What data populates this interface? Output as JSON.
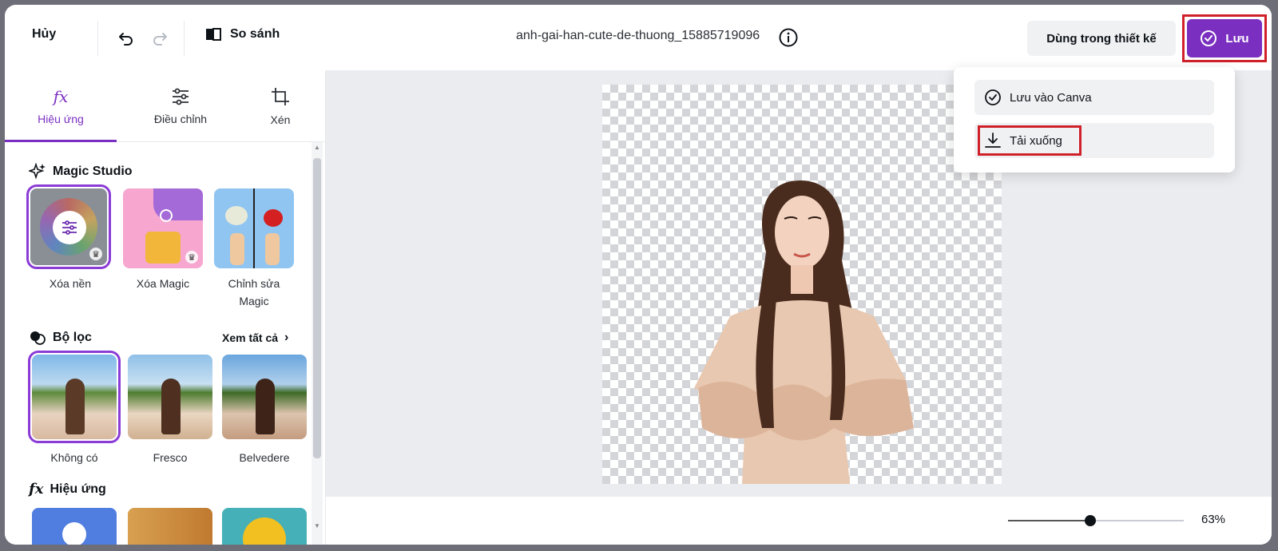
{
  "topbar": {
    "cancel_label": "Hủy",
    "compare_label": "So sánh",
    "filename": "anh-gai-han-cute-de-thuong_15885719096",
    "use_in_design_label": "Dùng trong thiết kế",
    "save_label": "Lưu"
  },
  "tabs": [
    {
      "label": "Hiệu ứng",
      "icon": "fx-icon",
      "active": true
    },
    {
      "label": "Điều chỉnh",
      "icon": "sliders-icon",
      "active": false
    },
    {
      "label": "Xén",
      "icon": "crop-icon",
      "active": false
    }
  ],
  "magic_studio": {
    "title": "Magic Studio",
    "items": [
      {
        "label": "Xóa nền",
        "premium": true
      },
      {
        "label": "Xóa Magic",
        "premium": true
      },
      {
        "label": "Chỉnh sửa Magic",
        "premium": false
      }
    ]
  },
  "filters": {
    "title": "Bộ lọc",
    "see_all": "Xem tất cả",
    "items": [
      {
        "label": "Không có",
        "selected": true
      },
      {
        "label": "Fresco",
        "selected": false
      },
      {
        "label": "Belvedere",
        "selected": false
      }
    ]
  },
  "effects": {
    "title": "Hiệu ứng"
  },
  "dropdown": {
    "save_to_canva": "Lưu vào Canva",
    "download": "Tải xuống"
  },
  "zoom": {
    "label": "63%",
    "value": 0.47
  },
  "colors": {
    "accent": "#7a2fc0",
    "highlight": "#d0212b"
  }
}
